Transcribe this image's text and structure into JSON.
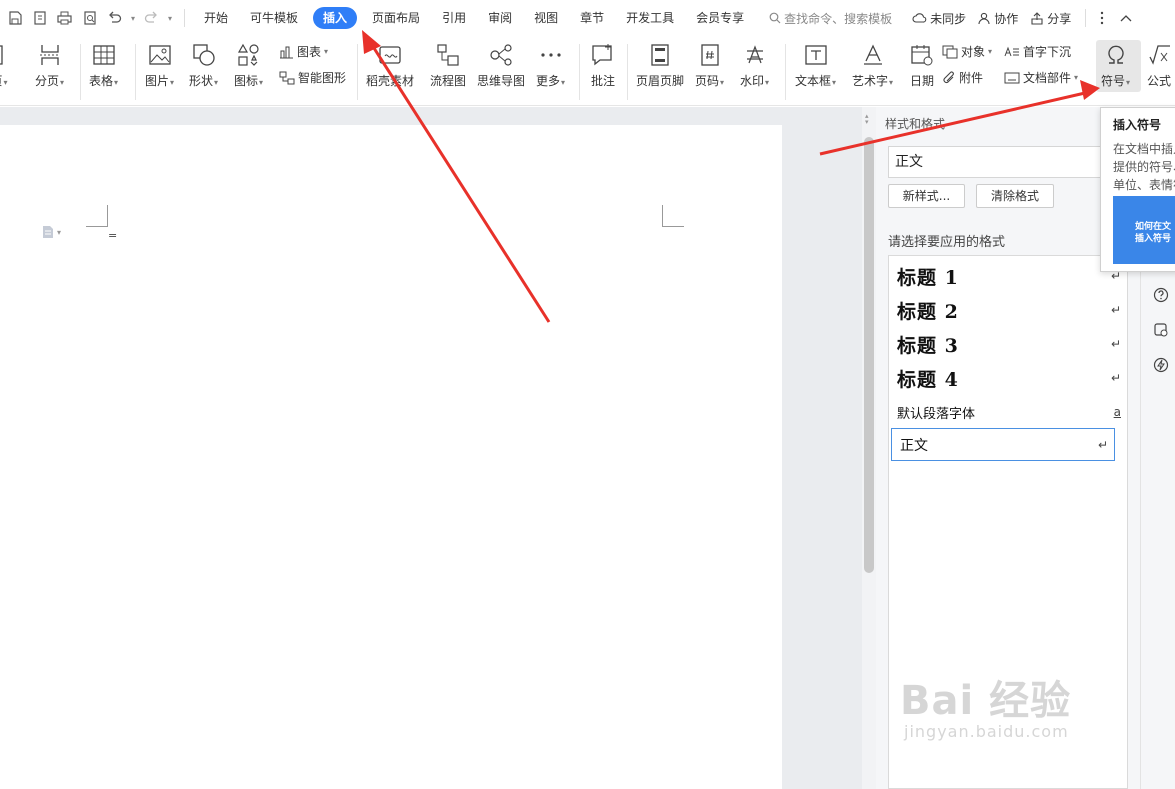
{
  "menubar": {
    "tabs": [
      "开始",
      "可牛模板",
      "插入",
      "页面布局",
      "引用",
      "审阅",
      "视图",
      "章节",
      "开发工具",
      "会员专享"
    ],
    "active_tab": "插入",
    "search_placeholder": "查找命令、搜索模板",
    "sync": "未同步",
    "collab": "协作",
    "share": "分享"
  },
  "ribbon": {
    "page": "页",
    "break": "分页",
    "table": "表格",
    "picture": "图片",
    "shape": "形状",
    "icon": "图标",
    "chart": "图表",
    "smart_graphic": "智能图形",
    "material": "稻壳素材",
    "flowchart": "流程图",
    "mindmap": "思维导图",
    "more": "更多",
    "comment": "批注",
    "header_footer": "页眉页脚",
    "page_number": "页码",
    "watermark": "水印",
    "textbox": "文本框",
    "wordart": "艺术字",
    "date": "日期",
    "object": "对象",
    "attachment": "附件",
    "dropcap": "首字下沉",
    "doc_parts": "文档部件",
    "symbol": "符号",
    "formula": "公式"
  },
  "document": {
    "para_mark": "="
  },
  "styles_panel": {
    "title": "样式和格式",
    "current_style": "正文",
    "new_style_label": "新样式...",
    "clear_format_label": "清除格式",
    "choose_label": "请选择要应用的格式",
    "styles": [
      {
        "name": "标题  1",
        "mark": "↵"
      },
      {
        "name": "标题  2",
        "mark": "↵"
      },
      {
        "name": "标题  3",
        "mark": "↵"
      },
      {
        "name": "标题  4",
        "mark": "↵"
      },
      {
        "name": "默认段落字体",
        "mark": "a"
      },
      {
        "name": "正文",
        "mark": "↵"
      }
    ]
  },
  "tooltip": {
    "title": "插入符号",
    "desc_line1": "在文档中插入",
    "desc_line2": "提供的符号、",
    "desc_line3": "单位、表情符",
    "thumb_line1": "如何在文",
    "thumb_line2": "插入符号"
  },
  "watermark": {
    "brand": "Bai 经验",
    "url": "jingyan.baidu.com"
  },
  "colors": {
    "accent": "#2f7ef7",
    "arrow": "#e8312a"
  }
}
